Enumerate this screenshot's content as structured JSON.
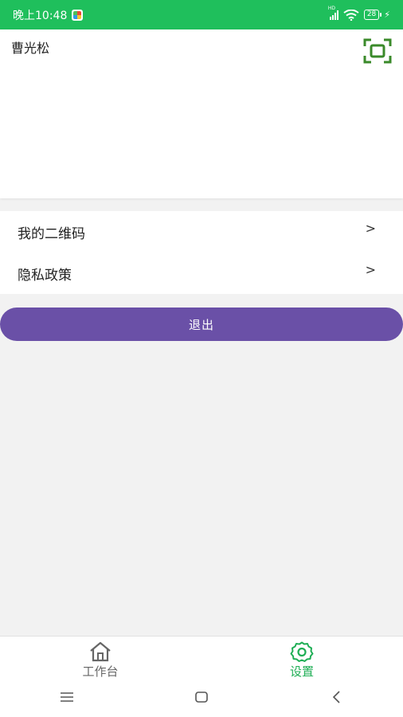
{
  "status_bar": {
    "time": "晚上10:48",
    "battery": "28",
    "hd": "HD"
  },
  "profile": {
    "name": "曹光松"
  },
  "menu": {
    "items": [
      {
        "label": "我的二维码",
        "chevron": ">"
      },
      {
        "label": "隐私政策",
        "chevron": ">"
      }
    ]
  },
  "logout": {
    "label": "退出"
  },
  "tabs": [
    {
      "label": "工作台",
      "icon": "home-icon",
      "active": false
    },
    {
      "label": "设置",
      "icon": "gear-icon",
      "active": true
    }
  ],
  "colors": {
    "status_bar": "#1fbf5c",
    "accent_green": "#1fae55",
    "logout_purple": "#6a50a7",
    "scan_green": "#3a8a2a"
  }
}
